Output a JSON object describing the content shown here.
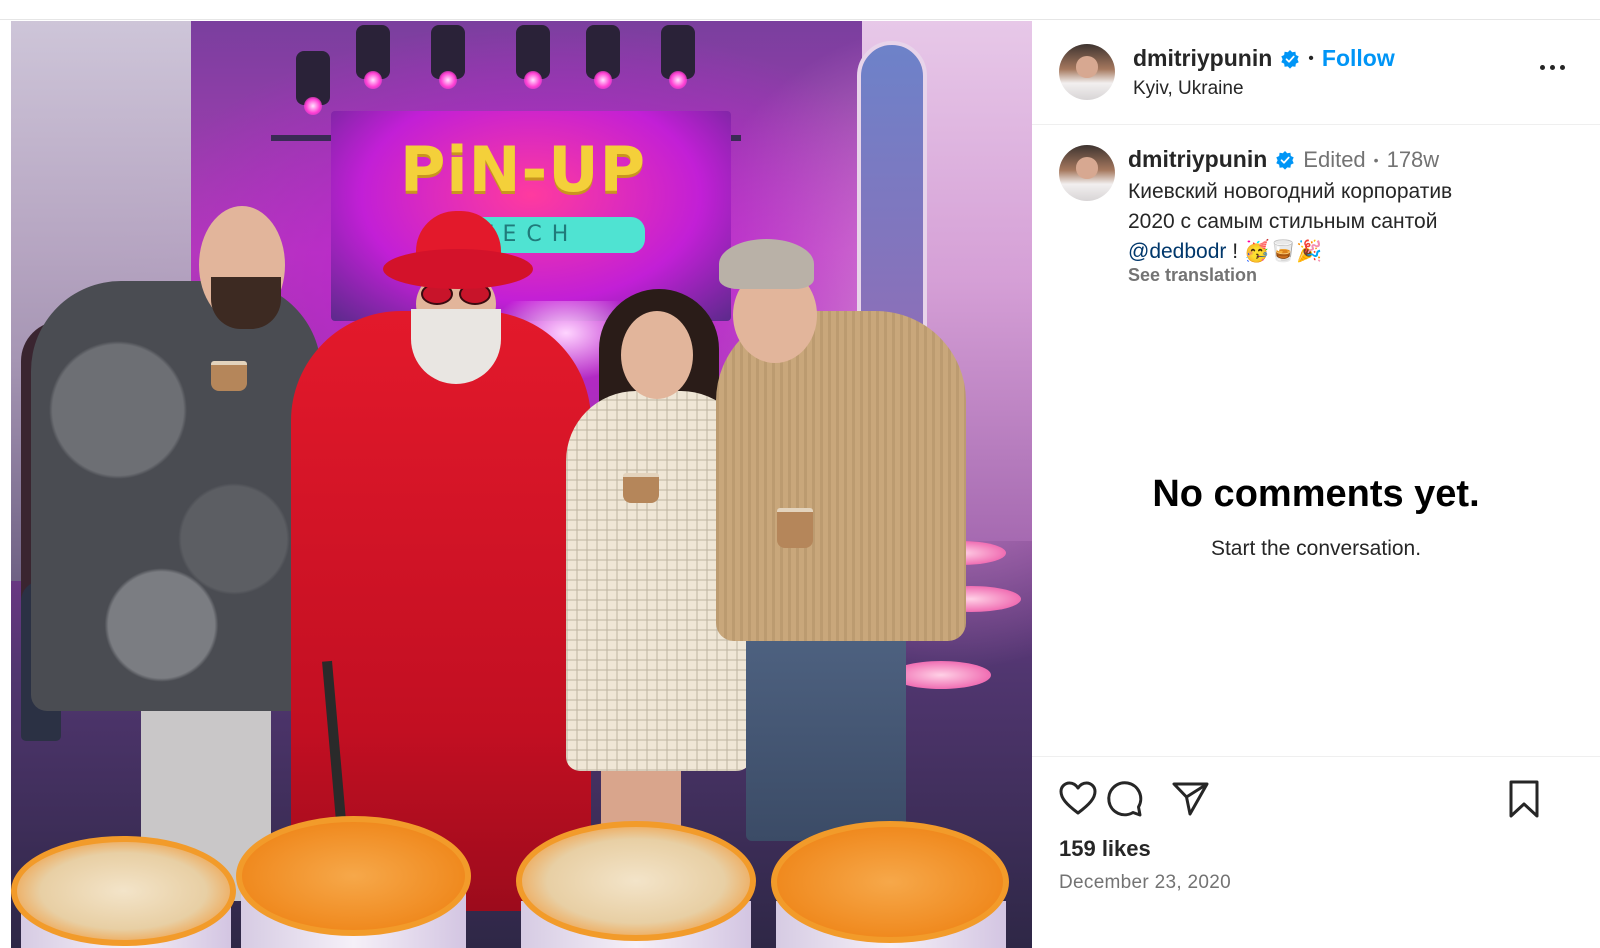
{
  "post": {
    "author": {
      "username": "dmitriypunin",
      "verified": true,
      "location": "Kyiv, Ukraine",
      "follow_label": "Follow"
    },
    "photo": {
      "brand_text": "PiN-UP",
      "brand_sub": "TECH"
    },
    "caption": {
      "username": "dmitriypunin",
      "edited_label": "Edited",
      "age": "178w",
      "line1": "Киевский новогодний корпоратив",
      "line2": "2020 с самым стильным сантой",
      "mention": "@dedbodr",
      "suffix": " ! 🥳🥃🎉",
      "see_translation": "See translation"
    },
    "comments": {
      "empty_title": "No comments yet.",
      "empty_subtitle": "Start the conversation."
    },
    "likes_label": "159 likes",
    "date": "December 23, 2020"
  },
  "colors": {
    "follow": "#0095f6",
    "verified": "#0095f6",
    "muted_text": "#737373",
    "mention": "#00376b"
  },
  "icons": [
    "more-options-icon",
    "verified-badge-icon",
    "heart-icon",
    "comment-icon",
    "share-icon",
    "bookmark-icon"
  ]
}
